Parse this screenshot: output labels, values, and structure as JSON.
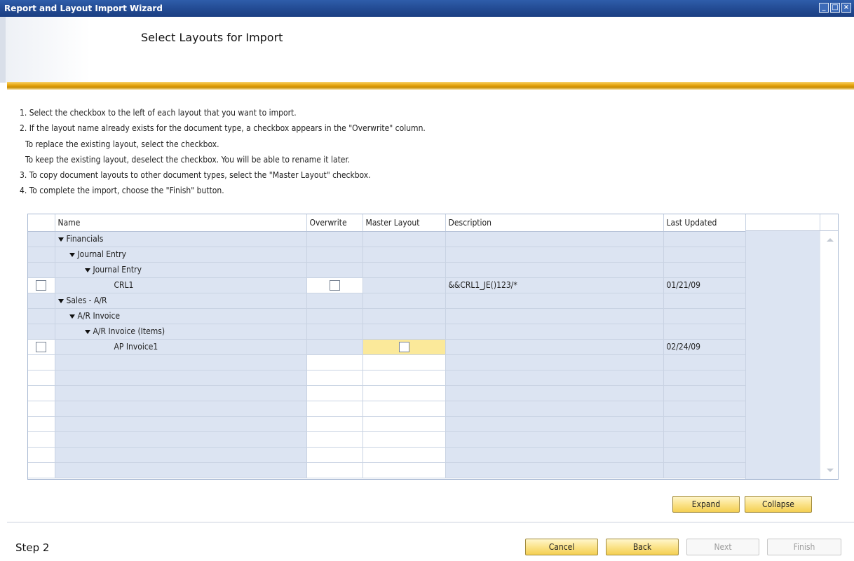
{
  "window": {
    "title": "Report and Layout Import Wizard"
  },
  "header": {
    "title": "Select Layouts for Import"
  },
  "instructions": [
    "1. Select the checkbox to the left of each layout that you want to import.",
    "2. If the layout name already exists for the document type, a checkbox appears in the \"Overwrite\" column.",
    "To replace the existing layout, select the checkbox.",
    "To keep the existing layout, deselect the checkbox. You will be able to rename it later.",
    "3. To copy document layouts to other document types, select the \"Master Layout\" checkbox.",
    "4. To complete the import, choose the \"Finish\" button."
  ],
  "grid": {
    "columns": [
      "Name",
      "Overwrite",
      "Master Layout",
      "Description",
      "Last Updated"
    ],
    "rows": [
      {
        "level": 0,
        "name": "Financials",
        "group": true
      },
      {
        "level": 1,
        "name": "Journal Entry",
        "group": true
      },
      {
        "level": 2,
        "name": "Journal Entry",
        "group": true
      },
      {
        "level": 3,
        "name": "CRL1",
        "group": false,
        "select": false,
        "overwrite": false,
        "description": "&&CRL1_JE()123/*",
        "last_updated": "01/21/09"
      },
      {
        "level": 0,
        "name": "Sales - A/R",
        "group": true
      },
      {
        "level": 1,
        "name": "A/R Invoice",
        "group": true
      },
      {
        "level": 2,
        "name": "A/R Invoice (Items)",
        "group": true
      },
      {
        "level": 3,
        "name": "AP Invoice1",
        "group": false,
        "select": false,
        "master": false,
        "description": "",
        "last_updated": "02/24/09"
      }
    ]
  },
  "buttons": {
    "expand": "Expand",
    "collapse": "Collapse",
    "cancel": "Cancel",
    "back": "Back",
    "next": "Next",
    "finish": "Finish"
  },
  "footer": {
    "step": "Step 2"
  },
  "colors": {
    "title_bar": "#224a92",
    "row_blue": "#dce4f2",
    "accent_gold": "#e8a712",
    "highlight_yellow": "#fbe99a"
  }
}
